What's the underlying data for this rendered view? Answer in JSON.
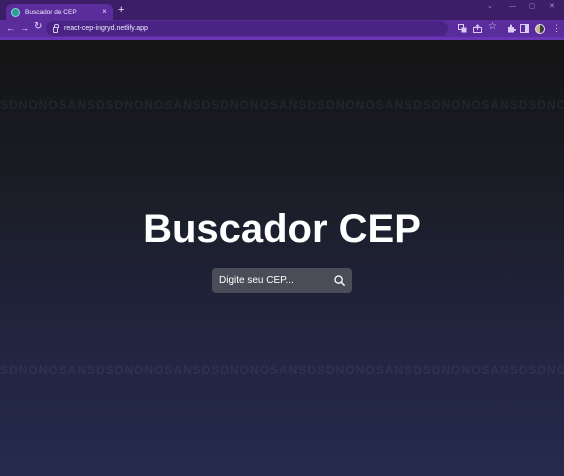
{
  "browser": {
    "tab_title": "Buscador de CEP",
    "tab_close": "×",
    "new_tab": "+",
    "url": "react-cep-ingryd.netlify.app",
    "window_controls": [
      "⌄",
      "—",
      "▢",
      "✕"
    ],
    "nav_icons": [
      "back-arrow-icon",
      "forward-arrow-icon",
      "reload-icon"
    ],
    "toolbar_icons": [
      "translate-icon",
      "share-icon",
      "star-icon",
      "extensions-icon",
      "sidebar-icon",
      "profile-avatar",
      "menu-icon"
    ]
  },
  "page": {
    "heading": "Buscador CEP",
    "search": {
      "placeholder": "Digite seu CEP...",
      "button_icon": "search-icon"
    },
    "background_marquee": "SDNONOSANSDSDNONOSANSDSDNONOSANSDSDNONOSANSDSDNONOSANSDSDNONOSANSD"
  },
  "colors": {
    "tabbar": "#3b1e66",
    "toolbar": "#5b2d9c",
    "omnibox": "#4a2484",
    "page_top": "#141414",
    "page_bottom": "#262a4c",
    "search_box": "#4a4c57",
    "heading_text": "#ffffff"
  }
}
